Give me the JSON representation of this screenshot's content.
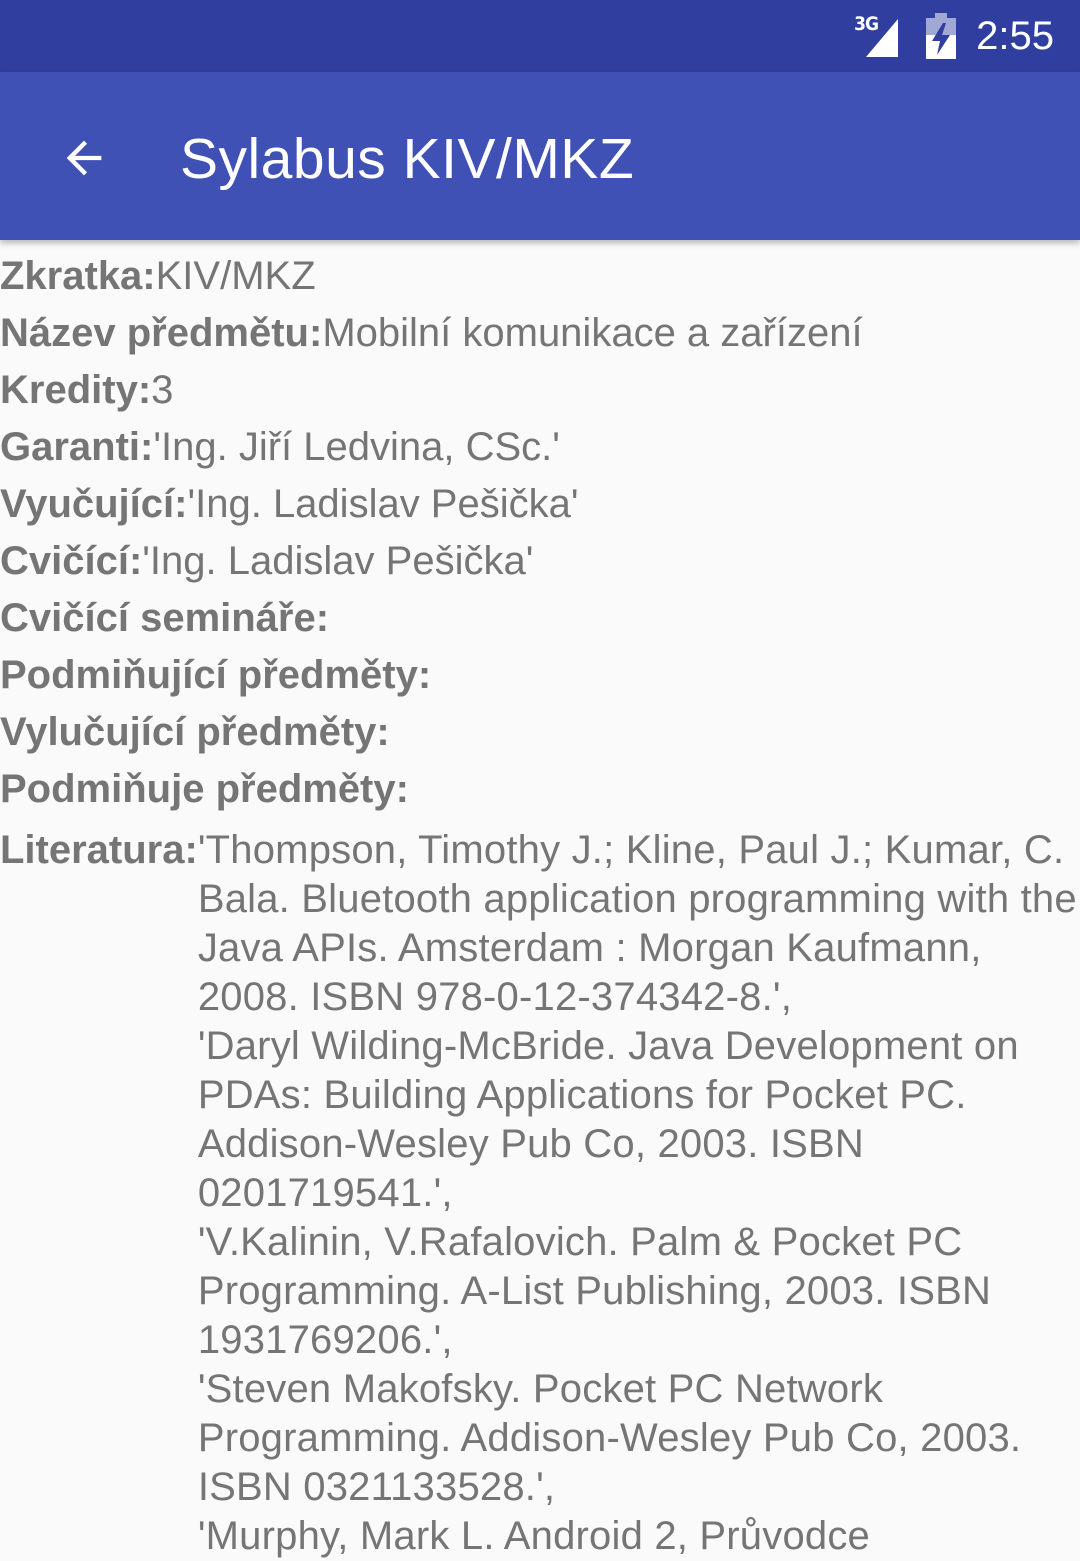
{
  "status_bar": {
    "network": "3G",
    "time": "2:55"
  },
  "app_bar": {
    "title": "Sylabus KIV/MKZ",
    "back_icon": "arrow-back-icon"
  },
  "fields": {
    "zkratka": {
      "label": "Zkratka:",
      "value": "KIV/MKZ"
    },
    "nazev": {
      "label": "Název předmětu:",
      "value": "Mobilní komunikace a zařízení"
    },
    "kredity": {
      "label": "Kredity:",
      "value": "3"
    },
    "garanti": {
      "label": "Garanti:",
      "value": "'Ing. Jiří Ledvina, CSc.'"
    },
    "vyucujici": {
      "label": "Vyučující:",
      "value": "'Ing. Ladislav Pešička'"
    },
    "cvicici": {
      "label": "Cvičící:",
      "value": "'Ing. Ladislav Pešička'"
    },
    "cvicici_seminare": {
      "label": "Cvičící semináře:",
      "value": ""
    },
    "podminujici": {
      "label": "Podmiňující předměty:",
      "value": ""
    },
    "vylucujici": {
      "label": "Vylučující předměty:",
      "value": ""
    },
    "podminuje": {
      "label": "Podmiňuje předměty:",
      "value": ""
    }
  },
  "literatura": {
    "label": "Literatura:",
    "entries": [
      "'Thompson, Timothy J.; Kline, Paul J.; Kumar, C. Bala. Bluetooth application programming with the Java APIs. Amsterdam : Morgan Kaufmann, 2008. ISBN 978-0-12-374342-8.',",
      "'Daryl Wilding-McBride. Java Development on PDAs: Building Applications for Pocket PC. Addison-Wesley Pub Co, 2003. ISBN 0201719541.',",
      "'V.Kalinin, V.Rafalovich. Palm & Pocket PC Programming. A-List Publishing, 2003. ISBN 1931769206.',",
      "'Steven Makofsky. Pocket PC Network Programming. Addison-Wesley Pub Co, 2003. ISBN 0321133528.',",
      "'Murphy, Mark L. Android 2, Průvodce"
    ]
  },
  "colors": {
    "status_bar": "#303f9f",
    "app_bar": "#3f51b5",
    "text": "#757575",
    "background": "#fafafa"
  }
}
